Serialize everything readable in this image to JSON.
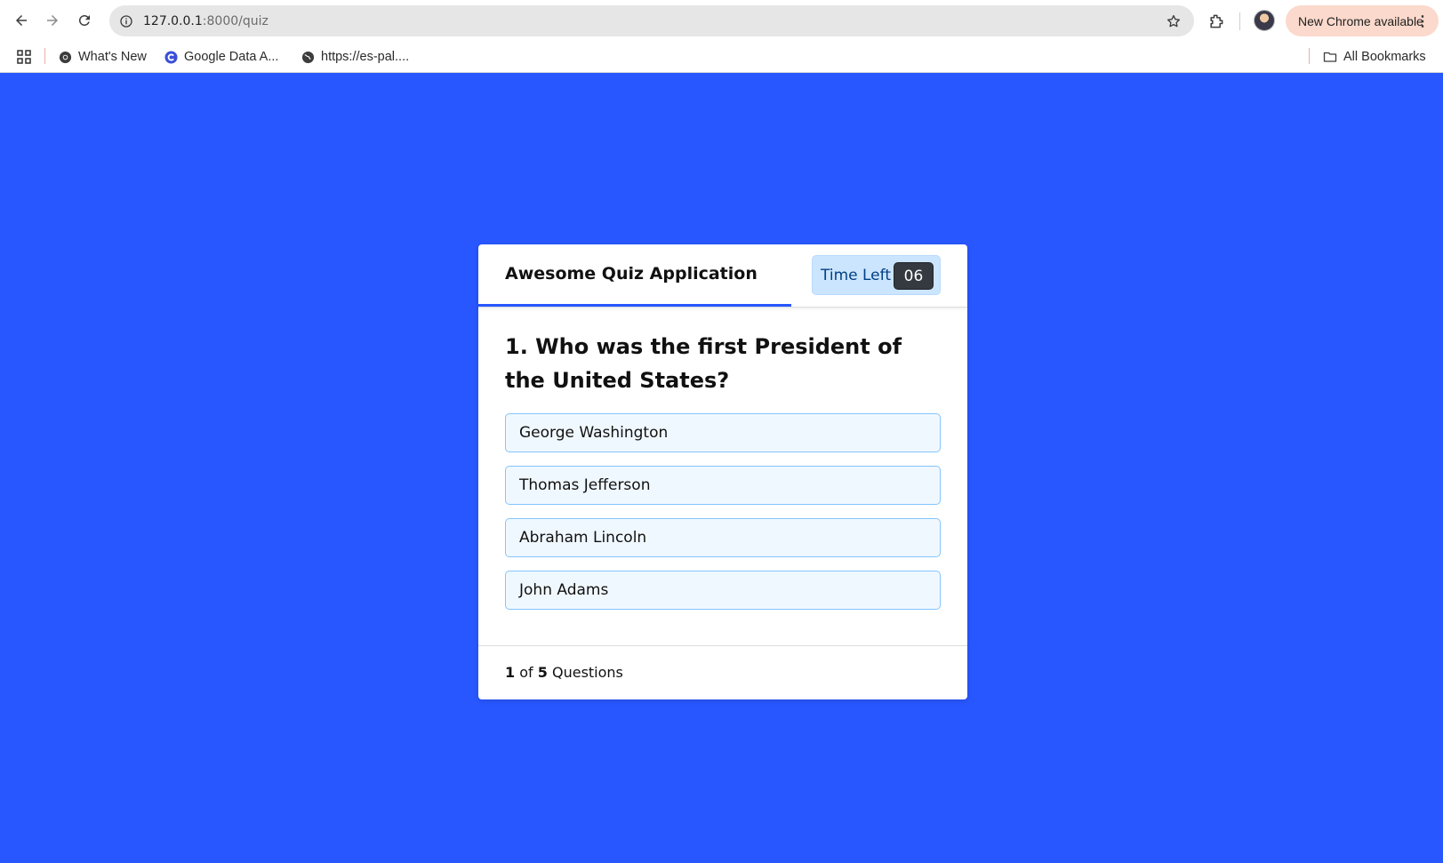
{
  "browser": {
    "url_host": "127.0.0.1",
    "url_path": ":8000/quiz",
    "update_label": "New Chrome available",
    "icons": {
      "back": "back-arrow-icon",
      "forward": "forward-arrow-icon",
      "reload": "reload-icon",
      "site_info": "site-info-icon",
      "bookmark_star": "star-icon",
      "extensions": "extensions-icon",
      "menu": "kebab-menu-icon"
    }
  },
  "bookmarks": {
    "items": [
      {
        "label": "What's New",
        "icon": "chrome-icon"
      },
      {
        "label": "Google Data A...",
        "icon": "google-icon"
      },
      {
        "label": "https://es-pal....",
        "icon": "globe-icon"
      }
    ],
    "all_bookmarks_label": "All Bookmarks"
  },
  "quiz": {
    "title": "Awesome Quiz Application",
    "time_label": "Time Left",
    "time_seconds": "06",
    "time_progress": 0.64,
    "question": "1. Who was the first President of the United States?",
    "options": [
      "George Washington",
      "Thomas Jefferson",
      "Abraham Lincoln",
      "John Adams"
    ],
    "footer": {
      "current": "1",
      "of": "of",
      "total": "5",
      "suffix": "Questions"
    }
  },
  "colors": {
    "page_background": "#2857ff",
    "timer_box": "#cce5ff",
    "timer_seconds": "#343a40",
    "option_background": "#f0f8ff",
    "option_border": "#84c5fe"
  }
}
